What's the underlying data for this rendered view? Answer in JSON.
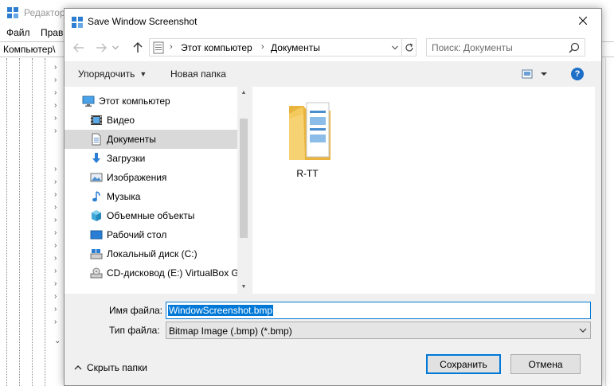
{
  "background_window": {
    "title": "Редактор",
    "menu": [
      "Файл",
      "Прав"
    ],
    "address": "Компьютер\\"
  },
  "dialog": {
    "title": "Save Window Screenshot",
    "close_glyph": "✕",
    "address": {
      "crumbs": [
        "Этот компьютер",
        "Документы"
      ],
      "separator": "›"
    },
    "search": {
      "placeholder": "Поиск: Документы"
    },
    "toolbar": {
      "organize": "Упорядочить",
      "new_folder": "Новая папка",
      "help": "?"
    },
    "nav": {
      "items": [
        {
          "label": "Этот компьютер",
          "icon": "computer-icon"
        },
        {
          "label": "Видео",
          "icon": "video-icon"
        },
        {
          "label": "Документы",
          "icon": "documents-icon",
          "selected": true
        },
        {
          "label": "Загрузки",
          "icon": "downloads-icon"
        },
        {
          "label": "Изображения",
          "icon": "pictures-icon"
        },
        {
          "label": "Музыка",
          "icon": "music-icon"
        },
        {
          "label": "Объемные объекты",
          "icon": "3d-objects-icon"
        },
        {
          "label": "Рабочий стол",
          "icon": "desktop-icon"
        },
        {
          "label": "Локальный диск (C:)",
          "icon": "drive-icon"
        },
        {
          "label": "CD-дисковод (E:) VirtualBox Gu",
          "icon": "cd-drive-icon"
        }
      ]
    },
    "files": [
      {
        "name": "R-TT",
        "icon": "folder-icon"
      }
    ],
    "filename": {
      "label": "Имя файла:",
      "value": "WindowScreenshot.bmp"
    },
    "filetype": {
      "label": "Тип файла:",
      "value": "Bitmap Image (.bmp) (*.bmp)"
    },
    "hide_folders": "Скрыть папки",
    "save_button": "Сохранить",
    "cancel_button": "Отмена"
  },
  "colors": {
    "accent": "#0078d7",
    "selection": "#d9d9d9",
    "dialog_bg": "#f0f0f0",
    "folder": "#f4c95d"
  }
}
